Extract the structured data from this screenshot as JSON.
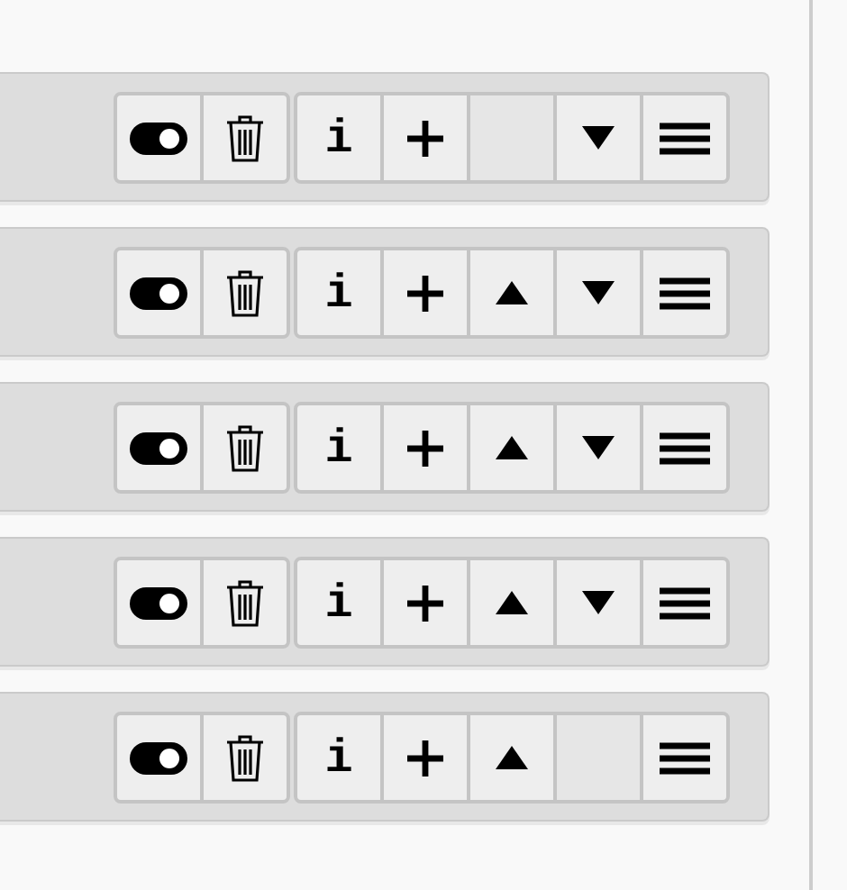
{
  "rows": [
    {
      "info_label": "i",
      "move_up": false,
      "move_down": true
    },
    {
      "info_label": "i",
      "move_up": true,
      "move_down": true
    },
    {
      "info_label": "i",
      "move_up": true,
      "move_down": true
    },
    {
      "info_label": "i",
      "move_up": true,
      "move_down": true
    },
    {
      "info_label": "i",
      "move_up": true,
      "move_down": false
    }
  ]
}
